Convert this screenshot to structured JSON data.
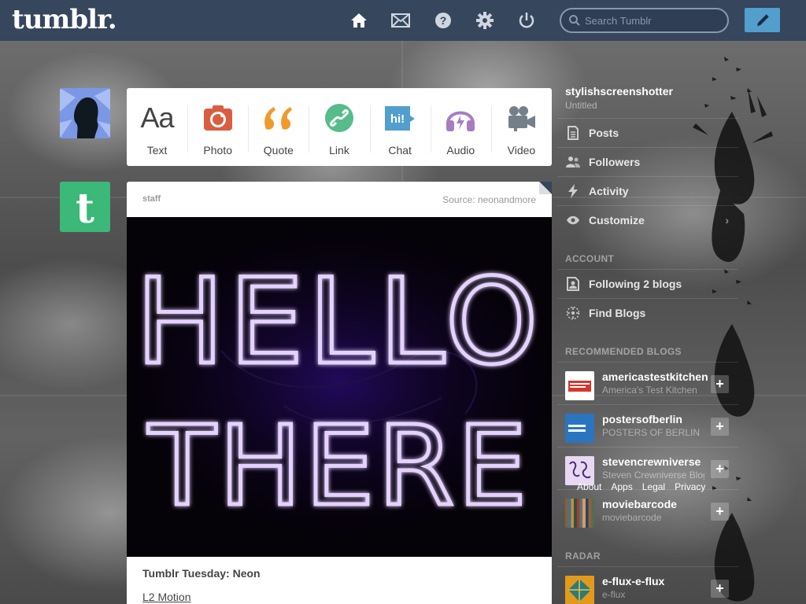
{
  "header": {
    "logo": "tumblr.",
    "search_placeholder": "Search Tumblr",
    "icons": [
      "home-icon",
      "mail-icon",
      "help-icon",
      "gear-icon",
      "power-icon"
    ]
  },
  "post_types": [
    {
      "label": "Text",
      "icon": "text-icon",
      "color": "#444444"
    },
    {
      "label": "Photo",
      "icon": "camera-icon",
      "color": "#d95e40"
    },
    {
      "label": "Quote",
      "icon": "quote-icon",
      "color": "#f2992e"
    },
    {
      "label": "Link",
      "icon": "link-icon",
      "color": "#56bc8a"
    },
    {
      "label": "Chat",
      "icon": "chat-icon",
      "color": "#529ecc"
    },
    {
      "label": "Audio",
      "icon": "headphones-icon",
      "color": "#a77dc2"
    },
    {
      "label": "Video",
      "icon": "video-camera-icon",
      "color": "#748089"
    }
  ],
  "post": {
    "user": "staff",
    "source": "Source: neonandmore",
    "image_text_line1": "HELLO",
    "image_text_line2": "THERE",
    "title": "Tumblr Tuesday: Neon",
    "link": "L2 Motion"
  },
  "sidebar": {
    "username": "stylishscreenshotter",
    "subtitle": "Untitled",
    "items": [
      {
        "label": "Posts",
        "icon": "posts-icon"
      },
      {
        "label": "Followers",
        "icon": "followers-icon"
      },
      {
        "label": "Activity",
        "icon": "activity-icon"
      },
      {
        "label": "Customize",
        "icon": "eye-icon"
      }
    ],
    "account_heading": "ACCOUNT",
    "account_items": [
      {
        "label": "Following 2 blogs",
        "icon": "following-icon"
      },
      {
        "label": "Find Blogs",
        "icon": "compass-icon"
      }
    ],
    "recommended_heading": "RECOMMENDED BLOGS",
    "recommended": [
      {
        "name": "americastestkitchen",
        "sub": "America's Test Kitchen"
      },
      {
        "name": "postersofberlin",
        "sub": "POSTERS OF BERLIN"
      },
      {
        "name": "stevencrewniverse",
        "sub": "Steven Crewniverse Blog"
      },
      {
        "name": "moviebarcode",
        "sub": "moviebarcode"
      }
    ],
    "radar_heading": "RADAR",
    "radar": {
      "name": "e-flux-e-flux",
      "sub": "e-flux"
    },
    "follow_symbol": "+"
  },
  "footer_links": [
    "About",
    "Apps",
    "Legal",
    "Privacy"
  ],
  "colors": {
    "header": "#36465d",
    "compose": "#529ecc",
    "accent": "#529ecc"
  }
}
